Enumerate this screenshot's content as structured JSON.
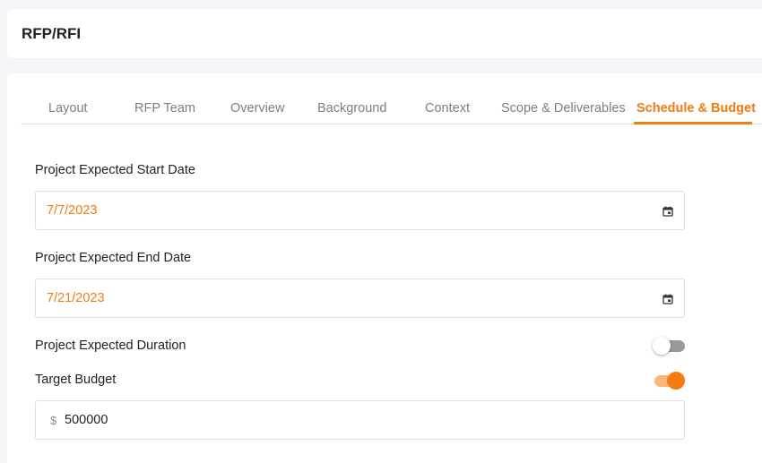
{
  "app": {
    "title": "RFP/RFI"
  },
  "tabs": [
    {
      "label": "Layout"
    },
    {
      "label": "RFP Team"
    },
    {
      "label": "Overview"
    },
    {
      "label": "Background"
    },
    {
      "label": "Context"
    },
    {
      "label": "Scope & Deliverables"
    },
    {
      "label": "Schedule & Budget",
      "active": true
    }
  ],
  "form": {
    "start_date": {
      "label": "Project Expected Start Date",
      "value": "7/7/2023",
      "icon": "calendar-icon"
    },
    "end_date": {
      "label": "Project Expected End Date",
      "value": "7/21/2023",
      "icon": "calendar-icon"
    },
    "duration": {
      "label": "Project Expected Duration",
      "toggle_on": false
    },
    "budget": {
      "label": "Target Budget",
      "toggle_on": true,
      "currency_symbol": "$",
      "value": "500000"
    }
  },
  "colors": {
    "accent": "#f47b0f",
    "accent_light": "#fbb77a",
    "muted_text": "#7b7f86"
  }
}
